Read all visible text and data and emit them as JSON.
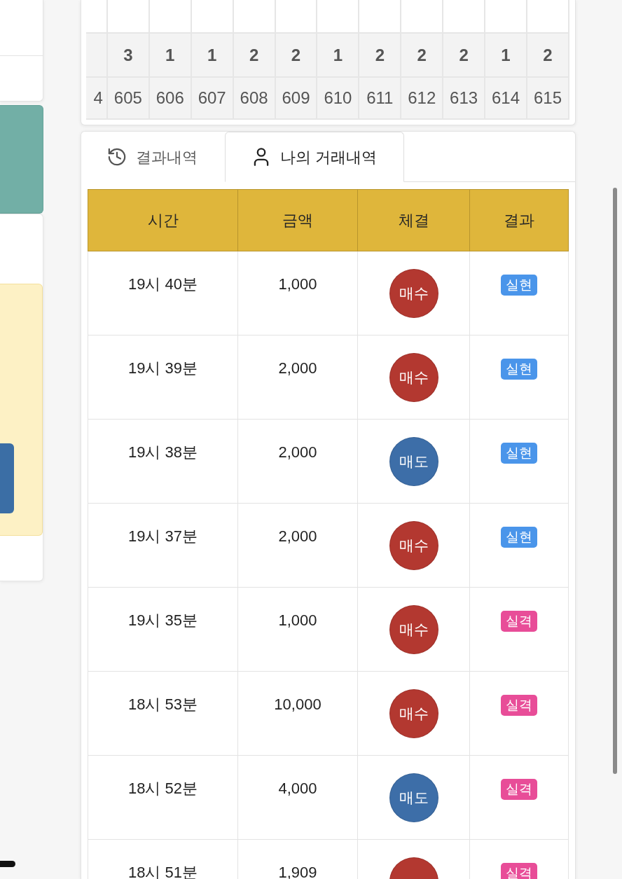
{
  "result_grid": {
    "cut_column": {
      "label": "4"
    },
    "columns": [
      {
        "value": "3",
        "label": "605"
      },
      {
        "value": "1",
        "label": "606"
      },
      {
        "value": "1",
        "label": "607"
      },
      {
        "value": "2",
        "label": "608"
      },
      {
        "value": "2",
        "label": "609"
      },
      {
        "value": "1",
        "label": "610"
      },
      {
        "value": "2",
        "label": "611"
      },
      {
        "value": "2",
        "label": "612"
      },
      {
        "value": "2",
        "label": "613"
      },
      {
        "value": "1",
        "label": "614"
      },
      {
        "value": "2",
        "label": "615"
      }
    ]
  },
  "tabs": [
    {
      "label": "결과내역",
      "selected": false
    },
    {
      "label": "나의 거래내역",
      "selected": true
    }
  ],
  "trade_table": {
    "columns": [
      "시간",
      "금액",
      "체결",
      "결과"
    ],
    "rows": [
      {
        "time": "19시 40분",
        "amount": "1,000",
        "trade": {
          "label": "매수",
          "color": "#b33830"
        },
        "result": {
          "label": "실현",
          "color": "#4a95ea"
        }
      },
      {
        "time": "19시 39분",
        "amount": "2,000",
        "trade": {
          "label": "매수",
          "color": "#b33830"
        },
        "result": {
          "label": "실현",
          "color": "#4a95ea"
        }
      },
      {
        "time": "19시 38분",
        "amount": "2,000",
        "trade": {
          "label": "매도",
          "color": "#3d6ea8"
        },
        "result": {
          "label": "실현",
          "color": "#4a95ea"
        }
      },
      {
        "time": "19시 37분",
        "amount": "2,000",
        "trade": {
          "label": "매수",
          "color": "#b33830"
        },
        "result": {
          "label": "실현",
          "color": "#4a95ea"
        }
      },
      {
        "time": "19시 35분",
        "amount": "1,000",
        "trade": {
          "label": "매수",
          "color": "#b33830"
        },
        "result": {
          "label": "실격",
          "color": "#e84d98"
        }
      },
      {
        "time": "18시 53분",
        "amount": "10,000",
        "trade": {
          "label": "매수",
          "color": "#b33830"
        },
        "result": {
          "label": "실격",
          "color": "#e84d98"
        }
      },
      {
        "time": "18시 52분",
        "amount": "4,000",
        "trade": {
          "label": "매도",
          "color": "#3d6ea8"
        },
        "result": {
          "label": "실격",
          "color": "#e84d98"
        }
      },
      {
        "time": "18시 51분",
        "amount": "1,909",
        "trade": {
          "color": "#b33830"
        },
        "result": {
          "label": "실격",
          "color": "#e84d98"
        }
      }
    ]
  }
}
